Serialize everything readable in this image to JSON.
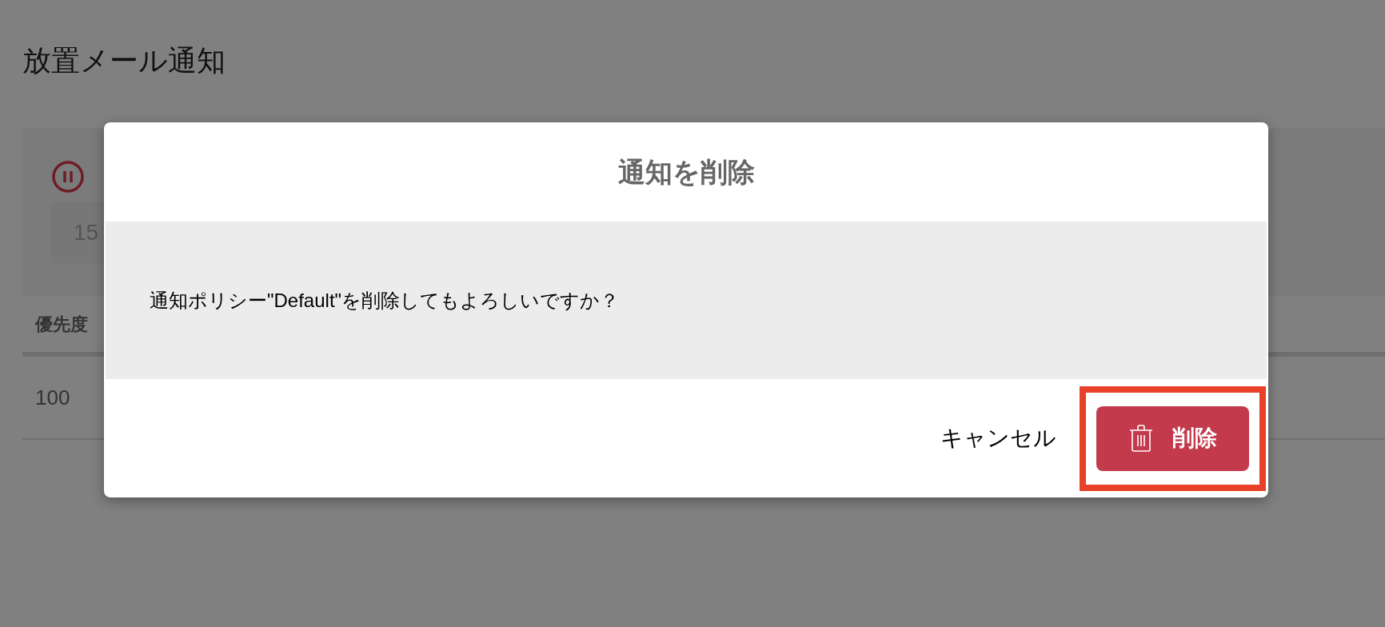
{
  "page": {
    "title": "放置メール通知"
  },
  "interval_field": {
    "value": "15"
  },
  "table": {
    "columns": [
      "優先度"
    ],
    "rows": [
      [
        "100"
      ]
    ]
  },
  "dialog": {
    "title": "通知を削除",
    "message": "通知ポリシー\"Default\"を削除してもよろしいですか？",
    "buttons": [
      {
        "label": "キャンセル",
        "kind": "text",
        "highlighted": false
      },
      {
        "label": "削除",
        "kind": "danger",
        "highlighted": true
      }
    ]
  }
}
